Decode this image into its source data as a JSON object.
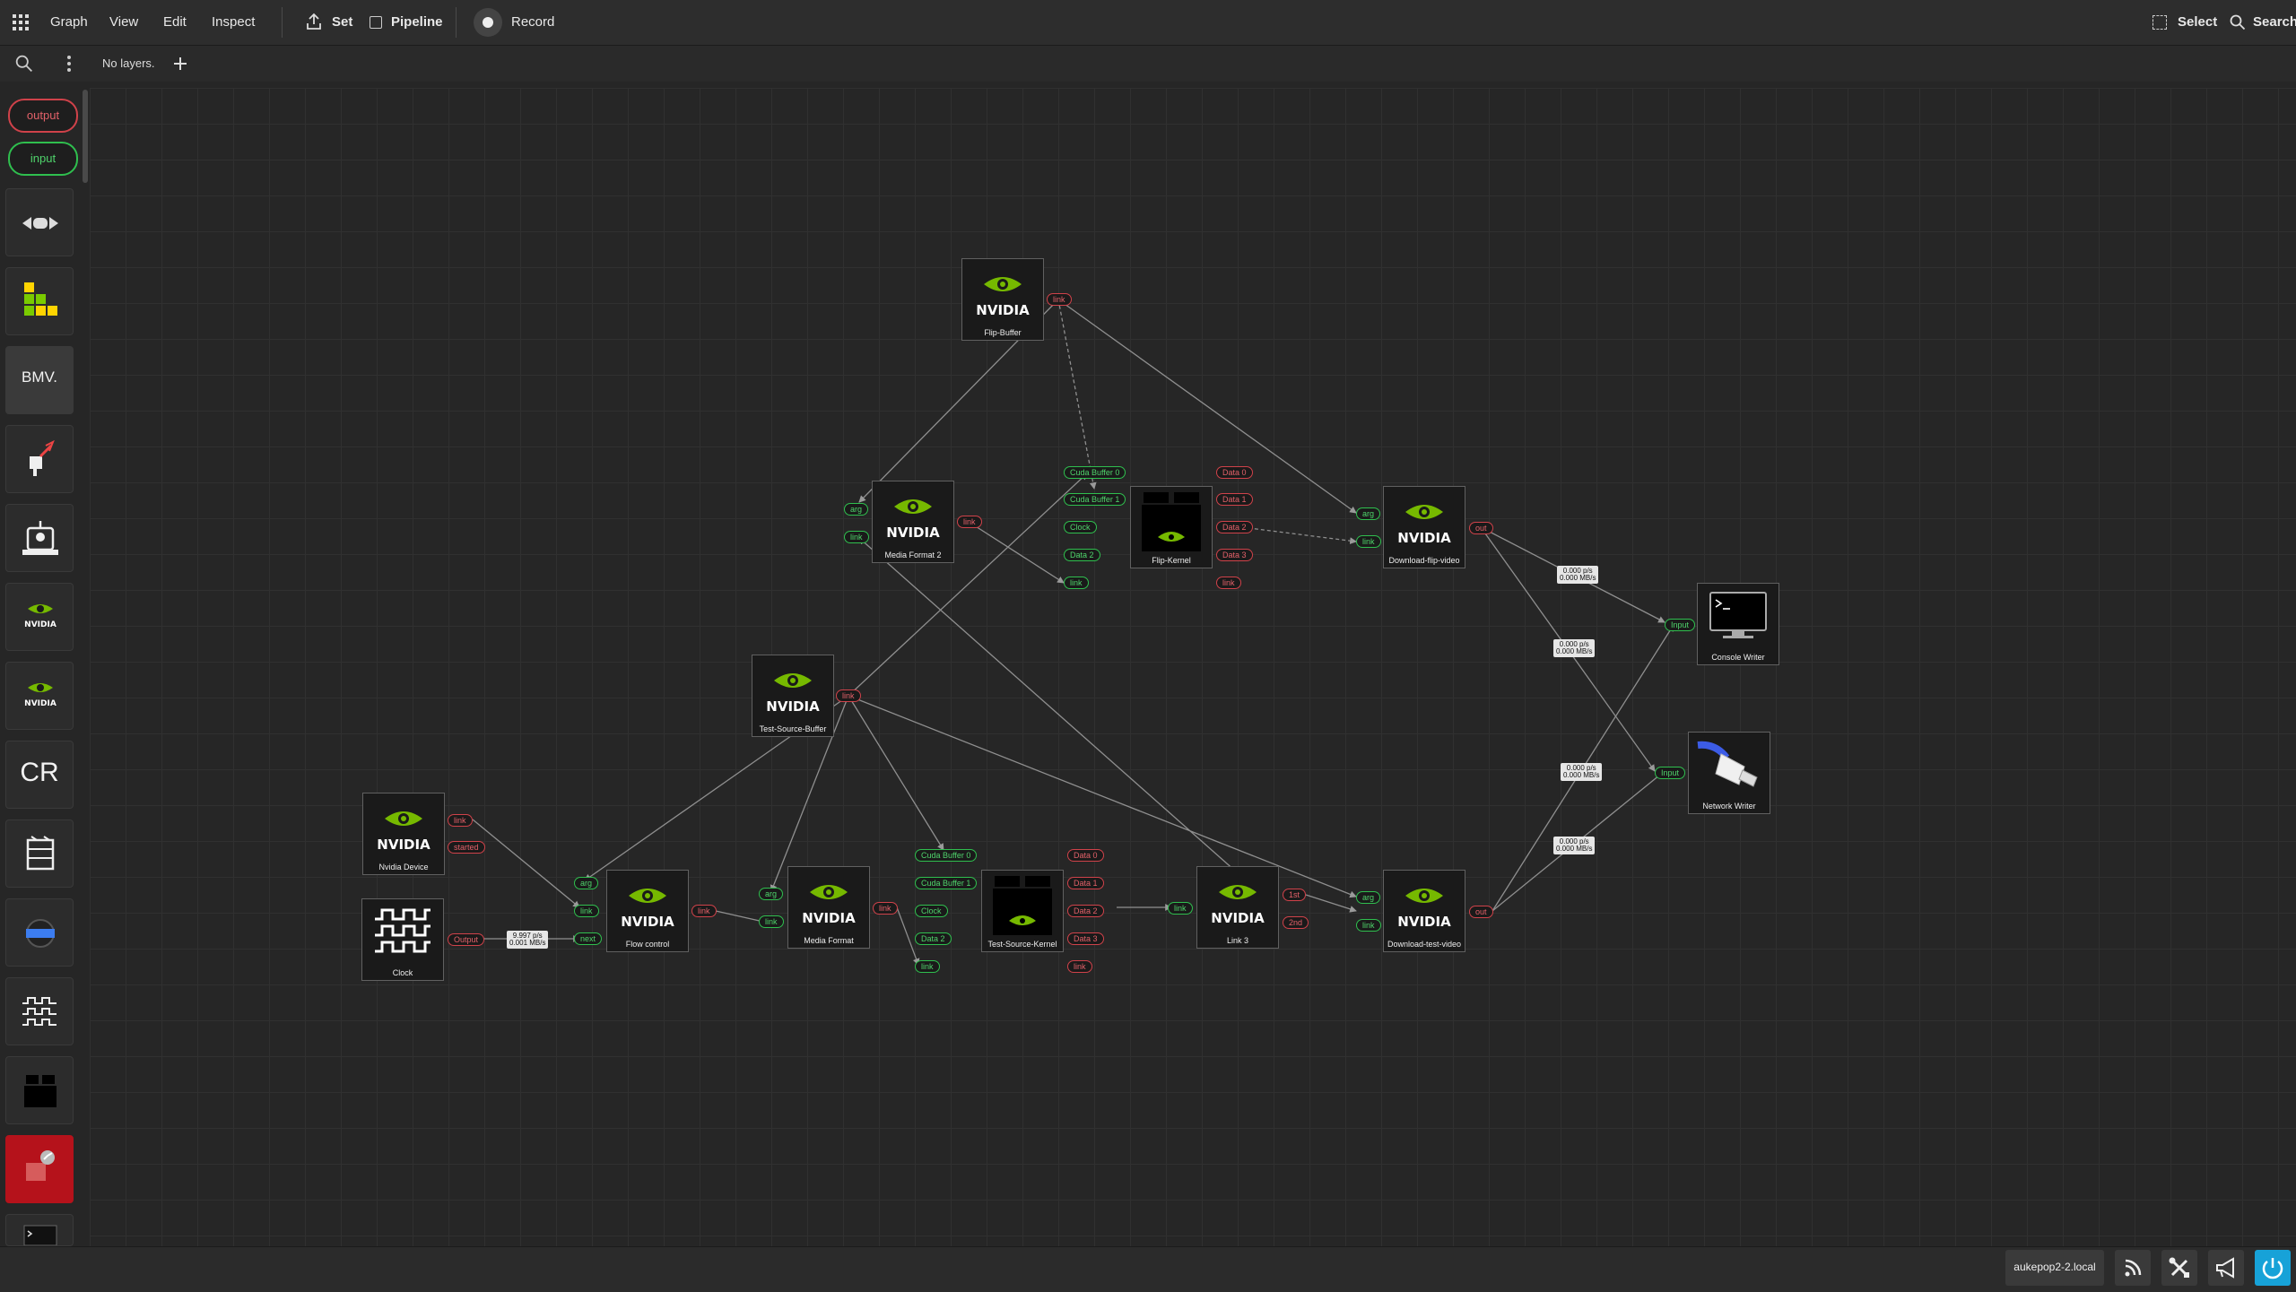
{
  "menu": {
    "graph": "Graph",
    "view": "View",
    "edit": "Edit",
    "inspect": "Inspect",
    "set": "Set",
    "pipeline": "Pipeline",
    "record": "Record",
    "select": "Select",
    "search": "Search"
  },
  "layers": {
    "text": "No layers."
  },
  "sidebar": {
    "output_label": "output",
    "input_label": "input",
    "bmv_label": "BMV.",
    "cr_label": "CR"
  },
  "host": "aukepop2-2.local",
  "colors": {
    "accent": "#17a2d8",
    "in_port": "#2fbf4e",
    "out_port": "#d0424a",
    "nvidia_green": "#76b900"
  },
  "nodes": {
    "flip_buffer": "Flip-Buffer",
    "media_format_2": "Media Format 2",
    "flip_kernel": "Flip-Kernel",
    "download_flip_video": "Download-flip-video",
    "console_writer": "Console Writer",
    "test_source_buffer": "Test-Source-Buffer",
    "network_writer": "Network Writer",
    "nvidia_device": "Nvidia Device",
    "clock": "Clock",
    "flow_control": "Flow control",
    "media_format": "Media Format",
    "test_source_kernel": "Test-Source-Kernel",
    "link_3": "Link 3",
    "download_test_video": "Download-test-video"
  },
  "ports": {
    "link": "link",
    "arg": "arg",
    "started": "started",
    "output": "Output",
    "next": "next",
    "out": "out",
    "input": "Input",
    "cuda_buffer_0": "Cuda Buffer 0",
    "cuda_buffer_1": "Cuda Buffer 1",
    "clock": "Clock",
    "data_0": "Data 0",
    "data_1": "Data 1",
    "data_2": "Data 2",
    "data_3": "Data 3",
    "first": "1st",
    "second": "2nd"
  },
  "rates": {
    "clock_flow_1": "9.997 p/s",
    "clock_flow_2": "0.001 MB/s",
    "zero_ps": "0.000 p/s",
    "zero_mbs": "0.000 MB/s"
  }
}
